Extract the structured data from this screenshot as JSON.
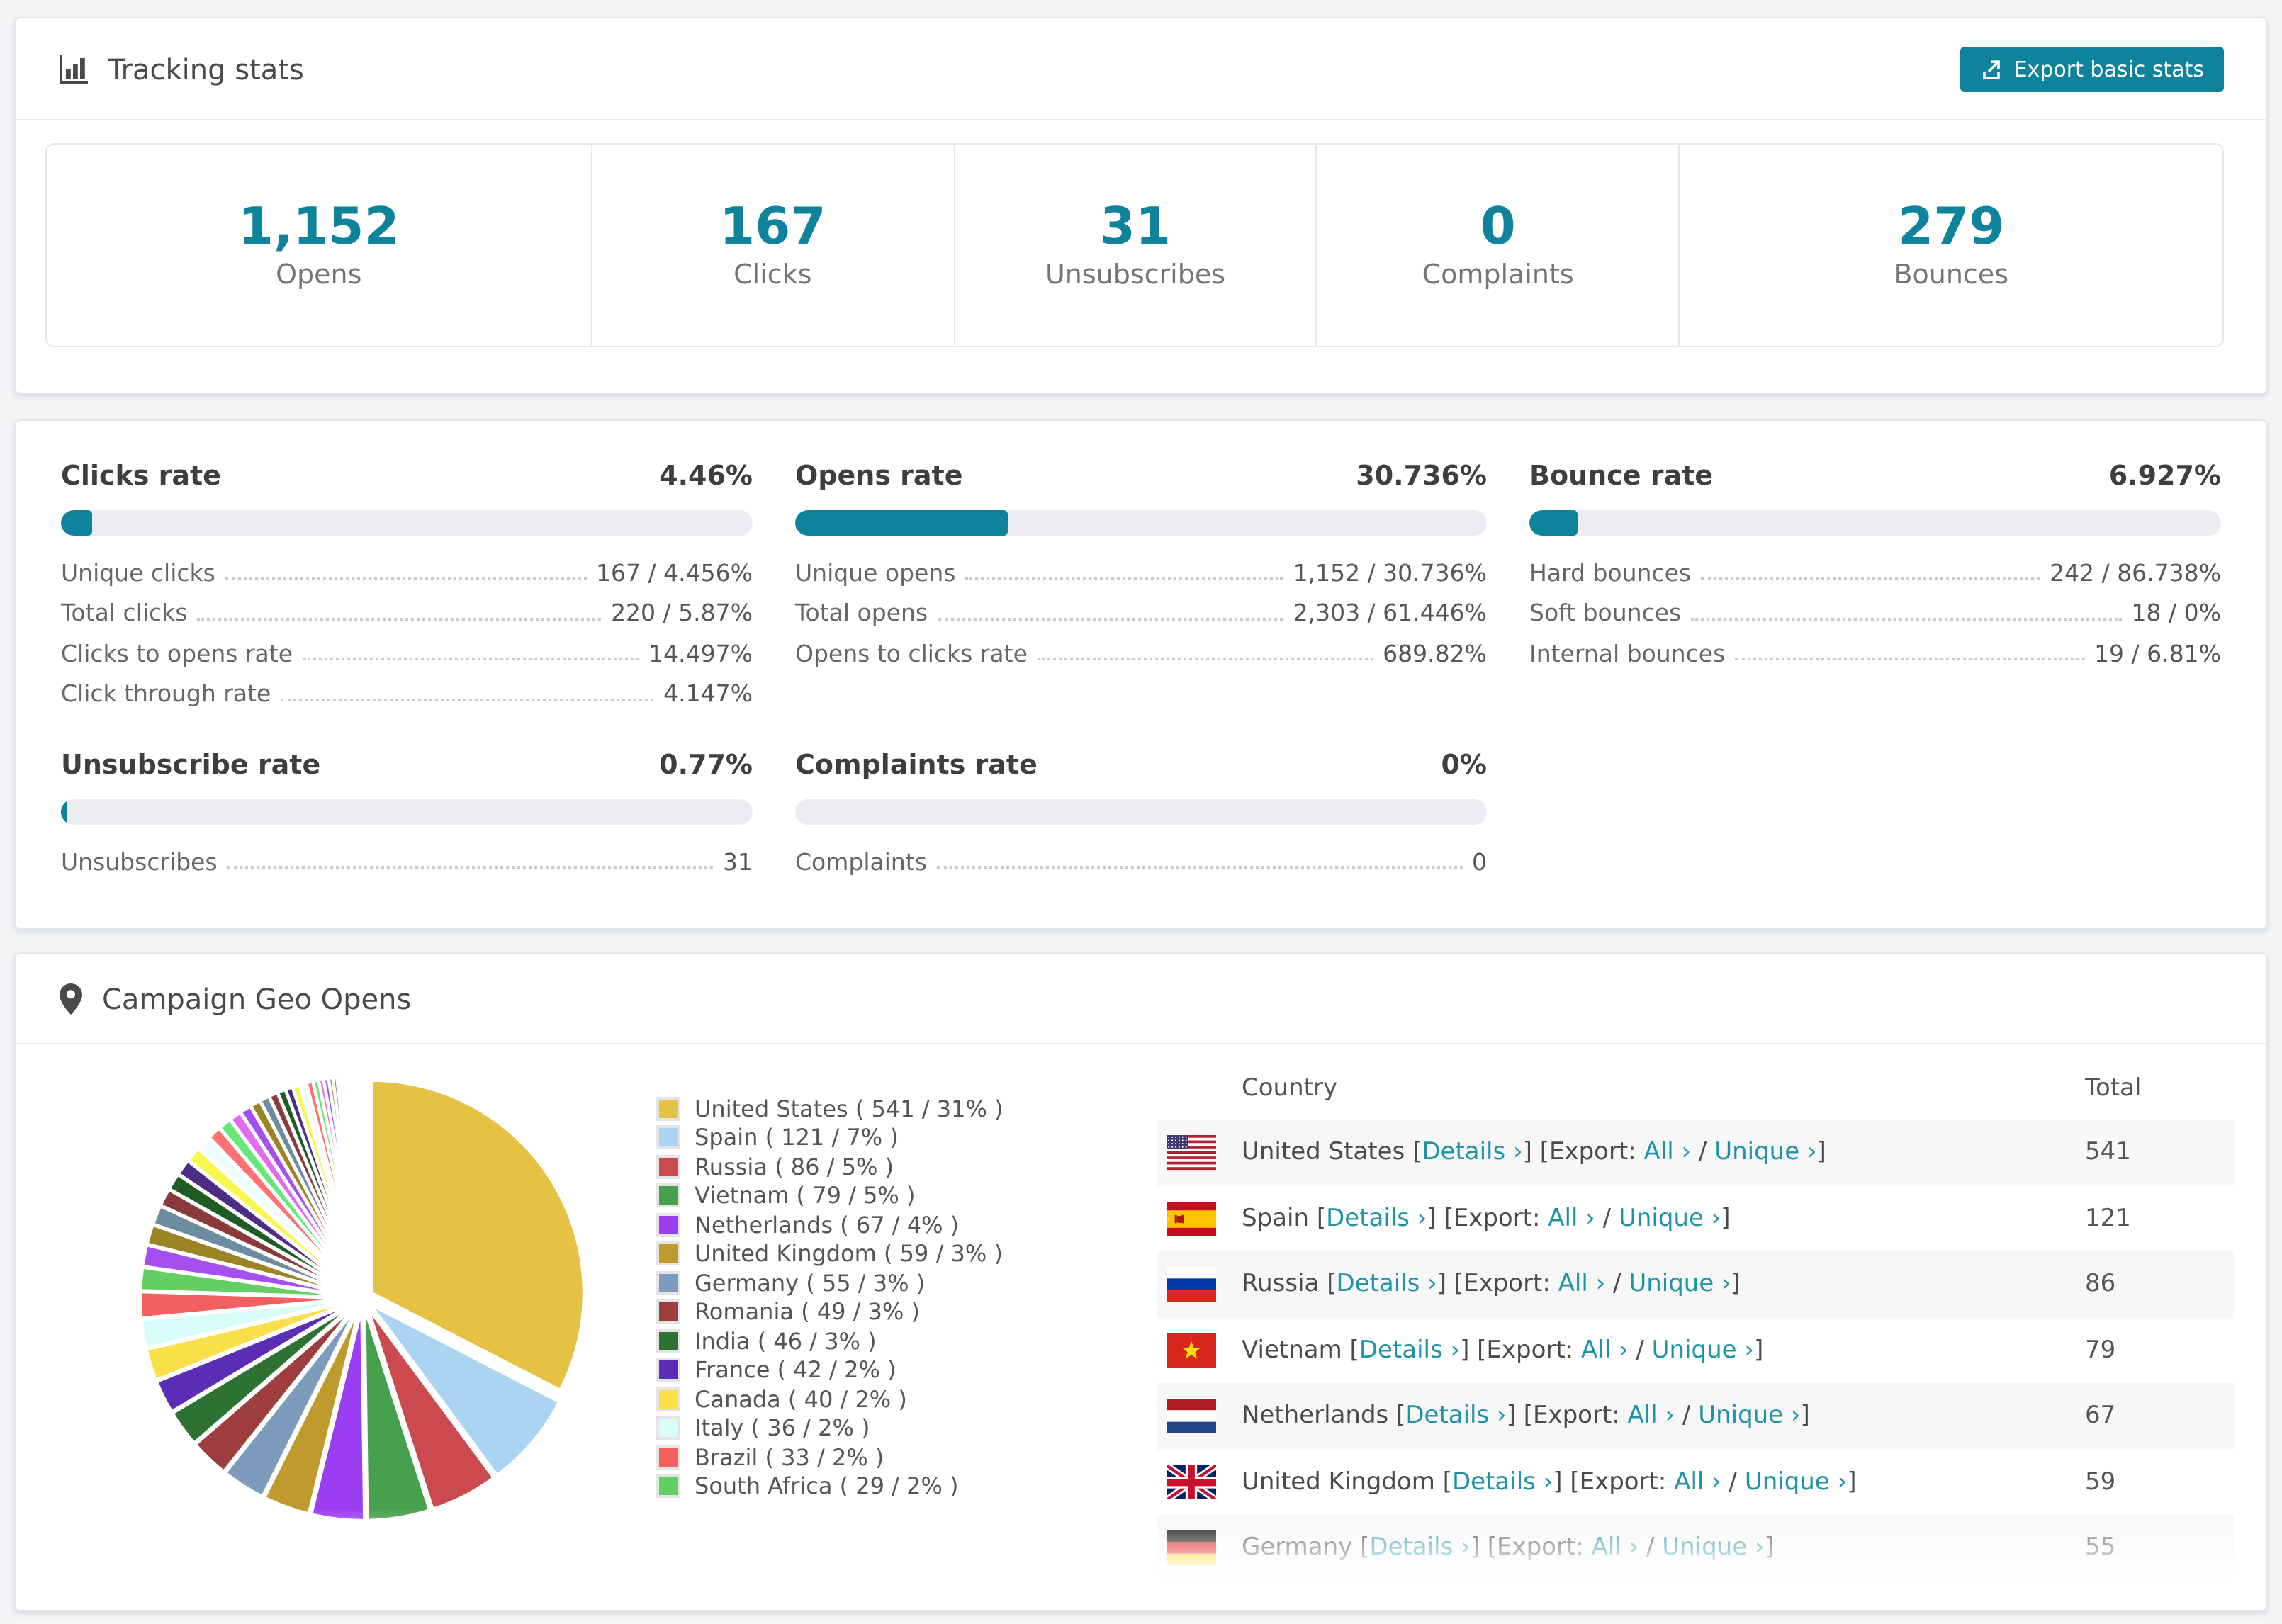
{
  "colors": {
    "accent": "#0F839C",
    "link": "#1E93A8",
    "bar_track": "#ECEDF0",
    "page_bg": "#F3F4F6",
    "row_alt_bg": "#F7F7F8"
  },
  "tracking": {
    "title": "Tracking stats",
    "export_label": "Export basic stats",
    "stats": [
      {
        "value": "1,152",
        "label": "Opens"
      },
      {
        "value": "167",
        "label": "Clicks"
      },
      {
        "value": "31",
        "label": "Unsubscribes"
      },
      {
        "value": "0",
        "label": "Complaints"
      },
      {
        "value": "279",
        "label": "Bounces"
      }
    ]
  },
  "rates": {
    "sections": [
      {
        "id": "clicks-rate",
        "title": "Clicks rate",
        "percent": "4.46%",
        "bar_percent": 4.46,
        "rows": [
          {
            "label": "Unique clicks",
            "value": "167 / 4.456%"
          },
          {
            "label": "Total clicks",
            "value": "220 / 5.87%"
          },
          {
            "label": "Clicks to opens rate",
            "value": "14.497%"
          },
          {
            "label": "Click through rate",
            "value": "4.147%"
          }
        ]
      },
      {
        "id": "opens-rate",
        "title": "Opens rate",
        "percent": "30.736%",
        "bar_percent": 30.736,
        "rows": [
          {
            "label": "Unique opens",
            "value": "1,152 / 30.736%"
          },
          {
            "label": "Total opens",
            "value": "2,303 / 61.446%"
          },
          {
            "label": "Opens to clicks rate",
            "value": "689.82%"
          }
        ]
      },
      {
        "id": "bounce-rate",
        "title": "Bounce rate",
        "percent": "6.927%",
        "bar_percent": 6.927,
        "rows": [
          {
            "label": "Hard bounces",
            "value": "242 / 86.738%"
          },
          {
            "label": "Soft bounces",
            "value": "18 / 0%"
          },
          {
            "label": "Internal bounces",
            "value": "19 / 6.81%"
          }
        ]
      },
      {
        "id": "unsubscribe-rate",
        "title": "Unsubscribe rate",
        "percent": "0.77%",
        "bar_percent": 0.77,
        "rows": [
          {
            "label": "Unsubscribes",
            "value": "31"
          }
        ]
      },
      {
        "id": "complaints-rate",
        "title": "Complaints rate",
        "percent": "0%",
        "bar_percent": 0,
        "rows": [
          {
            "label": "Complaints",
            "value": "0"
          }
        ]
      }
    ]
  },
  "geo": {
    "title": "Campaign Geo Opens",
    "table": {
      "headers": [
        "Country",
        "Total"
      ],
      "links": {
        "details": "Details ›",
        "export_prefix": "Export:",
        "all": "All ›",
        "unique": "Unique ›"
      },
      "rows": [
        {
          "country": "United States",
          "total": "541",
          "flag": "us"
        },
        {
          "country": "Spain",
          "total": "121",
          "flag": "es"
        },
        {
          "country": "Russia",
          "total": "86",
          "flag": "ru"
        },
        {
          "country": "Vietnam",
          "total": "79",
          "flag": "vn"
        },
        {
          "country": "Netherlands",
          "total": "67",
          "flag": "nl"
        },
        {
          "country": "United Kingdom",
          "total": "59",
          "flag": "gb"
        },
        {
          "country": "Germany",
          "total": "55",
          "flag": "de",
          "partially_visible": true
        }
      ]
    }
  },
  "chart_data": {
    "type": "pie",
    "title": "Campaign Geo Opens",
    "unit": "opens",
    "legend_position": "right",
    "legend_label_format": "{name} ( {value} / {percent}% )",
    "series": [
      {
        "name": "United States",
        "value": 541,
        "percent": 31,
        "color": "#E5C244"
      },
      {
        "name": "Spain",
        "value": 121,
        "percent": 7,
        "color": "#ABD3F2"
      },
      {
        "name": "Russia",
        "value": 86,
        "percent": 5,
        "color": "#CB4A50"
      },
      {
        "name": "Vietnam",
        "value": 79,
        "percent": 5,
        "color": "#47A04B"
      },
      {
        "name": "Netherlands",
        "value": 67,
        "percent": 4,
        "color": "#9B3DF0"
      },
      {
        "name": "United Kingdom",
        "value": 59,
        "percent": 3,
        "color": "#BF9A2C"
      },
      {
        "name": "Germany",
        "value": 55,
        "percent": 3,
        "color": "#7D9CBD"
      },
      {
        "name": "Romania",
        "value": 49,
        "percent": 3,
        "color": "#9E3D3D"
      },
      {
        "name": "India",
        "value": 46,
        "percent": 3,
        "color": "#2D7233"
      },
      {
        "name": "France",
        "value": 42,
        "percent": 2,
        "color": "#5B2DB5"
      },
      {
        "name": "Canada",
        "value": 40,
        "percent": 2,
        "color": "#F9E04B"
      },
      {
        "name": "Italy",
        "value": 36,
        "percent": 2,
        "color": "#D8FDF8"
      },
      {
        "name": "Brazil",
        "value": 33,
        "percent": 2,
        "color": "#F2605F"
      },
      {
        "name": "South Africa",
        "value": 29,
        "percent": 2,
        "color": "#63CF63"
      }
    ],
    "others_estimated_values": [
      27,
      25,
      24,
      22,
      21,
      20,
      19,
      18,
      17,
      16,
      15,
      14,
      13,
      12,
      11,
      10,
      9,
      9,
      8,
      8,
      7,
      6,
      6,
      5,
      5,
      4,
      4,
      3,
      3,
      3,
      2,
      2,
      2,
      2,
      1,
      1,
      1,
      1,
      1,
      1
    ],
    "others_palette": [
      "#A64FF0",
      "#9C8326",
      "#6E8CA0",
      "#8A3A3A",
      "#1F5C24",
      "#4B2E83",
      "#F7F750",
      "#EDFFFC",
      "#FF7070",
      "#66E878",
      "#E06CF2"
    ]
  }
}
